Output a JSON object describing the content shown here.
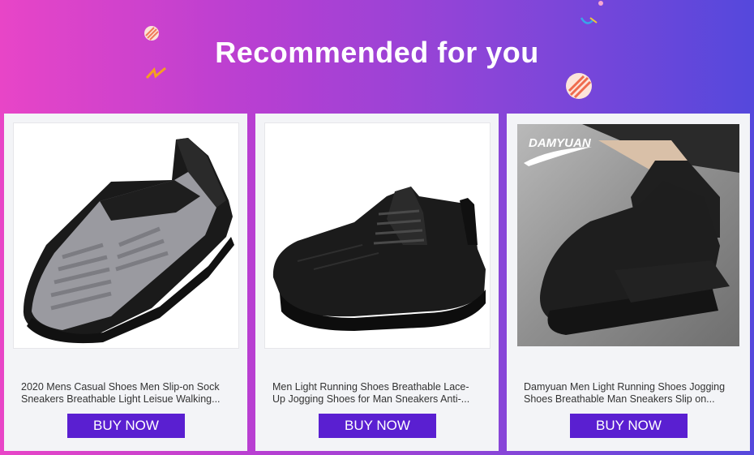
{
  "header": {
    "title": "Recommended for you"
  },
  "products": [
    {
      "name_line1": "2020 Mens Casual Shoes Men Slip-on Sock",
      "name_line2": "Sneakers Breathable Light Leisue Walking...",
      "button": "BUY NOW",
      "image_icon": "gray-slip-on-sneaker"
    },
    {
      "name_line1": "Men Light Running Shoes Breathable Lace-",
      "name_line2": "Up Jogging Shoes for Man Sneakers Anti-...",
      "button": "BUY NOW",
      "image_icon": "black-lace-up-sneaker"
    },
    {
      "name_line1": "Damyuan Men Light Running Shoes Jogging",
      "name_line2": "Shoes Breathable Man Sneakers Slip on...",
      "button": "BUY NOW",
      "image_icon": "black-sock-sneaker-photo",
      "brand_logo": "DAMYUAN"
    }
  ],
  "colors": {
    "button": "#5a1fd1",
    "card": "#f3f4f7"
  }
}
